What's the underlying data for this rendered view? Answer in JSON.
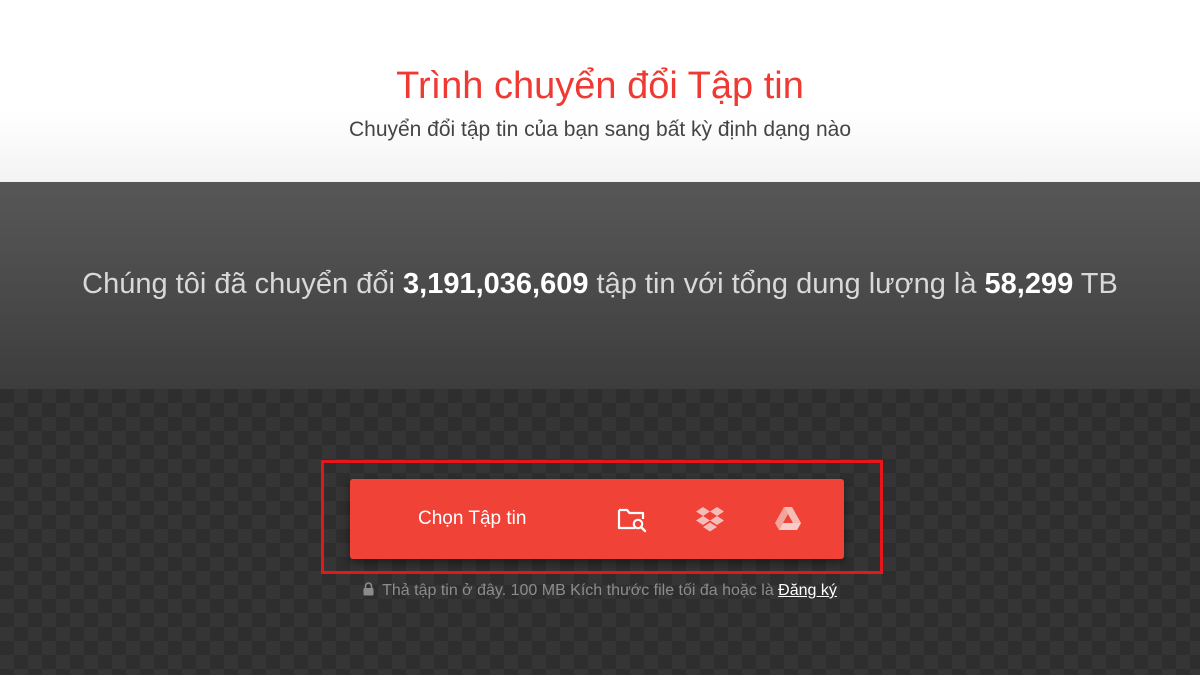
{
  "header": {
    "title": "Trình chuyển đổi Tập tin",
    "subtitle": "Chuyển đổi tập tin của bạn sang bất kỳ định dạng nào"
  },
  "stats": {
    "prefix": "Chúng tôi đã chuyển đổi",
    "file_count": "3,191,036,609",
    "middle": "tập tin với tổng dung lượng là",
    "total_size": "58,299",
    "unit": "TB"
  },
  "uploader": {
    "choose_label": "Chọn Tập tin",
    "sources": [
      {
        "icon": "folder-search-icon"
      },
      {
        "icon": "dropbox-icon"
      },
      {
        "icon": "google-drive-icon"
      }
    ],
    "note_text": "Thả tập tin ở đây. 100 MB Kích thước file tối đa hoặc là",
    "signup_link": "Đăng ký",
    "lock_icon": "lock-icon"
  },
  "colors": {
    "accent": "#ee3a32",
    "button": "#f04236",
    "highlight": "#e8161b"
  }
}
